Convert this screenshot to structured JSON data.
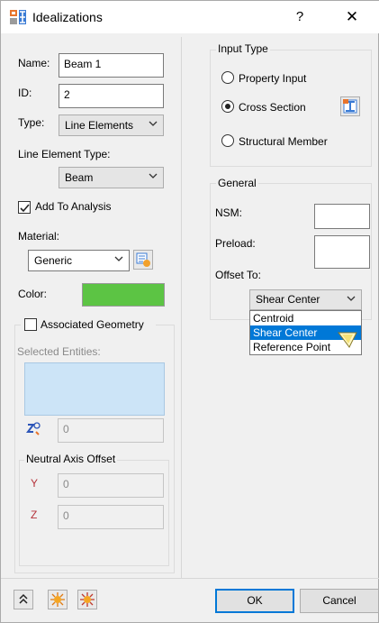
{
  "window": {
    "title": "Idealizations",
    "help": "?",
    "close": "✕"
  },
  "left": {
    "name_label": "Name:",
    "name_value": "Beam 1",
    "id_label": "ID:",
    "id_value": "2",
    "type_label": "Type:",
    "type_value": "Line Elements",
    "line_element_type_label": "Line Element Type:",
    "line_element_type_value": "Beam",
    "add_to_analysis_label": "Add To Analysis",
    "add_to_analysis_checked": true,
    "material_label": "Material:",
    "material_value": "Generic",
    "color_label": "Color:",
    "color_value": "#5cc444",
    "associated_geometry_label": "Associated Geometry",
    "associated_geometry_checked": false,
    "selected_entities_label": "Selected Entities:",
    "count_value": "0",
    "neutral_axis_offset_title": "Neutral Axis Offset",
    "y_label": "Y",
    "y_value": "0",
    "z_label": "Z",
    "z_value": "0"
  },
  "right": {
    "input_type_title": "Input Type",
    "options": [
      {
        "label": "Property Input",
        "selected": false
      },
      {
        "label": "Cross Section",
        "selected": true
      },
      {
        "label": "Structural Member",
        "selected": false
      }
    ],
    "general_title": "General",
    "nsm_label": "NSM:",
    "nsm_value": "",
    "preload_label": "Preload:",
    "preload_value": "",
    "offset_to_label": "Offset To:",
    "offset_to_value": "Shear Center",
    "offset_options": [
      "Centroid",
      "Shear Center",
      "Reference Point"
    ],
    "offset_selected_index": 1
  },
  "footer": {
    "ok_label": "OK",
    "cancel_label": "Cancel"
  },
  "colors": {
    "accent": "#0078d7",
    "selection_box": "#cce4f7",
    "red_label": "#b5323a"
  }
}
